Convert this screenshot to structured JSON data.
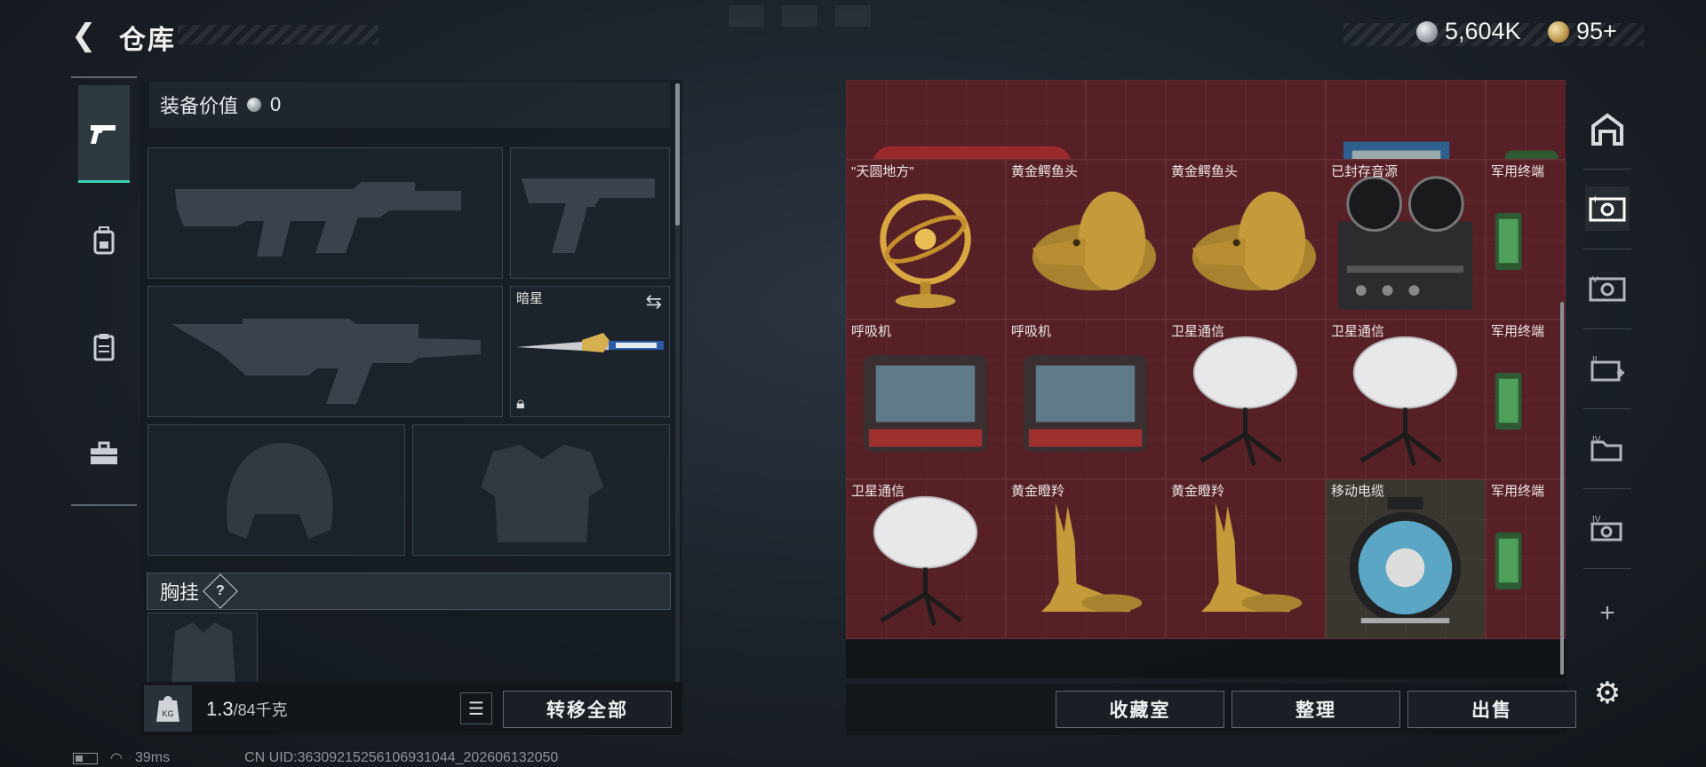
{
  "header": {
    "title": "仓库",
    "back_icon": "back-arrow-icon"
  },
  "currency": [
    {
      "icon": "silver-coin-icon",
      "value": "5,604K"
    },
    {
      "icon": "gold-coin-icon",
      "value": "95+"
    }
  ],
  "left_nav": {
    "tabs": [
      {
        "icon": "pistol-icon",
        "active": true
      },
      {
        "icon": "backpack-icon",
        "active": false
      },
      {
        "icon": "clipboard-icon",
        "active": false
      },
      {
        "icon": "toolbox-icon",
        "active": false
      }
    ]
  },
  "loadout": {
    "equip_value_label": "装备价值",
    "equip_value": "0",
    "melee_slot_name": "暗星",
    "chest_rig_label": "胸挂",
    "chest_rig_help": "?",
    "weight_current": "1.3",
    "weight_max": "/84千克",
    "transfer_all_label": "转移全部"
  },
  "stash": {
    "rows": [
      [
        "",
        "",
        "",
        ""
      ],
      [
        "\"天圆地方\"",
        "黄金鳄鱼头",
        "黄金鳄鱼头",
        "已封存音源",
        "军用终端"
      ],
      [
        "呼吸机",
        "呼吸机",
        "卫星通信",
        "卫星通信",
        "军用终端"
      ],
      [
        "卫星通信",
        "黄金瞪羚",
        "黄金瞪羚",
        "移动电缆",
        "军用终端"
      ]
    ],
    "buttons": {
      "collection": "收藏室",
      "organize": "整理",
      "sell": "出售"
    }
  },
  "right_nav": {
    "icons": [
      "safe-house-icon",
      "stash-tab-icon-1",
      "stash-tab-icon-5",
      "stash-tab-icon-2",
      "stash-tab-icon-4a",
      "stash-tab-icon-4b",
      "add-tab-icon",
      "settings-icon"
    ],
    "labels": [
      "",
      "",
      "V",
      "II",
      "IV",
      "IV",
      "+",
      ""
    ]
  },
  "footer": {
    "ping": "39ms",
    "uid": "CN UID:363092152561069310​44_202606132050"
  },
  "colors": {
    "accent": "#3fd1b4",
    "stash_cell": "#562026"
  }
}
